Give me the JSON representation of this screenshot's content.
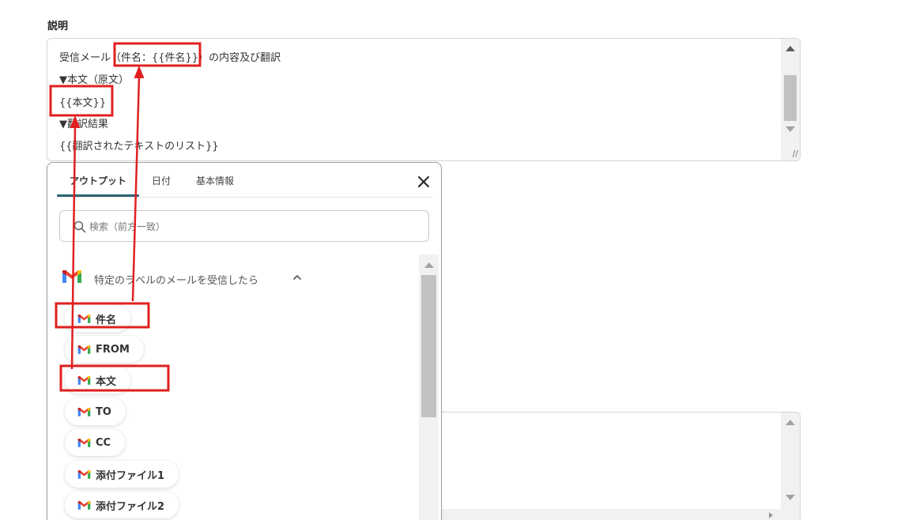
{
  "field": {
    "label": "説明",
    "lines": [
      "受信メール（件名：{{件名}}）の内容及び翻訳",
      "▼本文（原文）",
      "{{本文}}",
      "▼翻訳結果",
      "{{翻訳されたテキストのリスト}}"
    ]
  },
  "panel": {
    "tabs": [
      "アウトプット",
      "日付",
      "基本情報"
    ],
    "active_tab": "アウトプット",
    "search": {
      "placeholder": "検索（前方一致）",
      "value": ""
    },
    "group": {
      "title": "特定のラベルのメールを受信したら",
      "expanded": true,
      "icon": "gmail-icon"
    },
    "items": [
      "件名",
      "FROM",
      "本文",
      "TO",
      "CC",
      "添付ファイル1",
      "添付ファイル2"
    ]
  },
  "colors": {
    "accent_tab": "#2f6473",
    "annotation": "#e02020",
    "gmail_red": "#ea4335",
    "gmail_blue": "#4285f4",
    "gmail_green": "#34a853",
    "gmail_yellow": "#fbbc04"
  }
}
